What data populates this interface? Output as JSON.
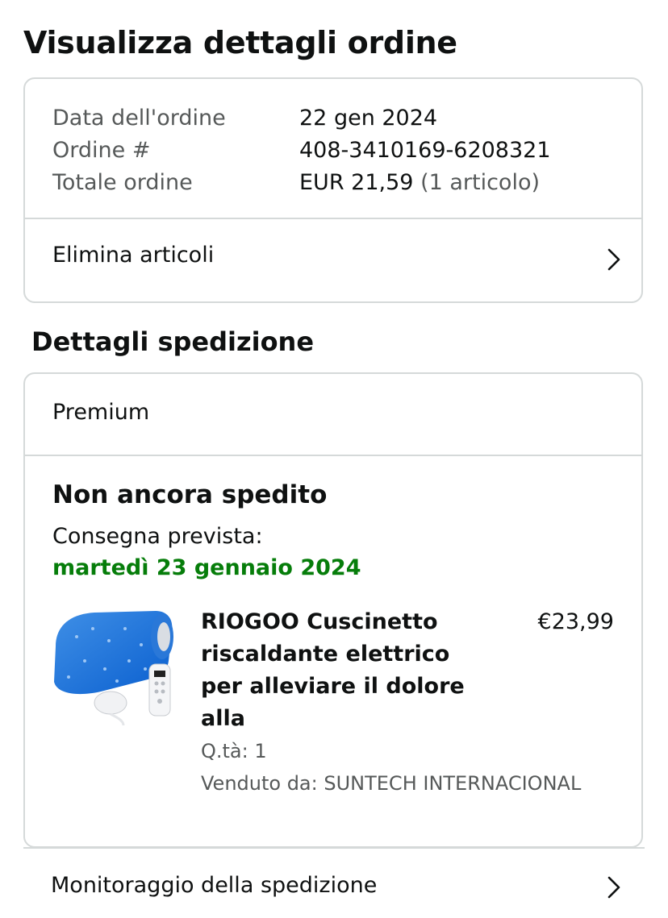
{
  "page": {
    "title": "Visualizza dettagli ordine"
  },
  "order_summary": {
    "rows": [
      {
        "label": "Data dell'ordine",
        "value": "22 gen 2024",
        "extra": ""
      },
      {
        "label": "Ordine #",
        "value": "408-3410169-6208321",
        "extra": ""
      },
      {
        "label": "Totale ordine",
        "value": "EUR 21,59",
        "extra": "(1 articolo)"
      }
    ],
    "delete_items_label": "Elimina articoli"
  },
  "shipping": {
    "section_title": "Dettagli spedizione",
    "shipping_type": "Premium",
    "status": "Non ancora spedito",
    "delivery_label": "Consegna prevista:",
    "delivery_date": "martedì 23 gennaio 2024",
    "delivery_date_color": "#067d0a",
    "product": {
      "title": "RIOGOO Cuscinetto riscaldante elettrico per alleviare il dolore alla",
      "price": "€23,99",
      "quantity": "Q.tà: 1",
      "seller": "Venduto da: SUNTECH INTERNACIONAL",
      "image_icon": "heating-pad-product-image"
    }
  },
  "tracking": {
    "label": "Monitoraggio della spedizione"
  },
  "icons": {
    "row_arrow": "chevron-right-icon"
  }
}
